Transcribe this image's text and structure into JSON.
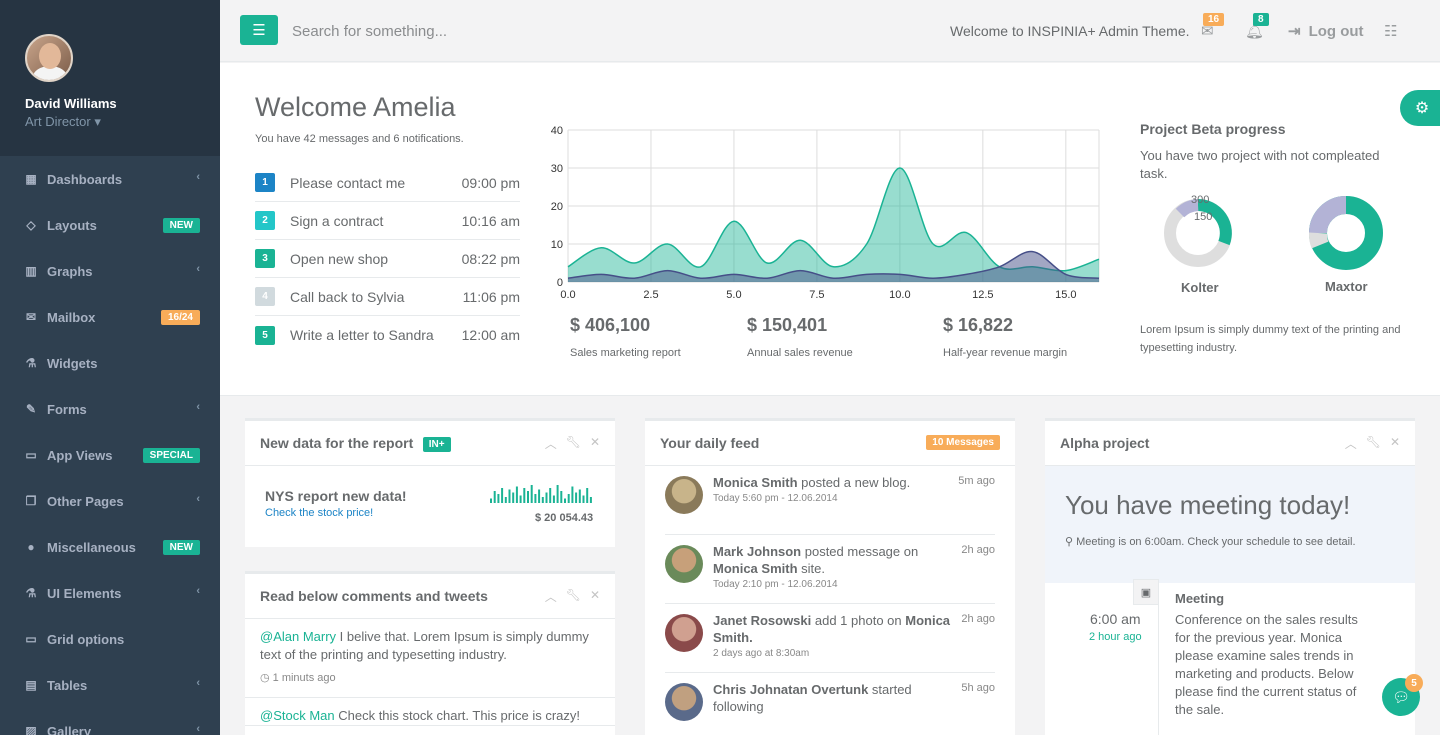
{
  "profile": {
    "name": "David Williams",
    "role": "Art Director ▾"
  },
  "nav": [
    {
      "label": "Dashboards",
      "icon": "th-large-icon",
      "chevron": true
    },
    {
      "label": "Layouts",
      "icon": "diamond-icon",
      "badge": "NEW",
      "badge_color": "#1ab394"
    },
    {
      "label": "Graphs",
      "icon": "bar-chart-icon",
      "chevron": true
    },
    {
      "label": "Mailbox",
      "icon": "envelope-icon",
      "badge": "16/24",
      "badge_color": "#f8ac59"
    },
    {
      "label": "Widgets",
      "icon": "flask-icon"
    },
    {
      "label": "Forms",
      "icon": "edit-icon",
      "chevron": true
    },
    {
      "label": "App Views",
      "icon": "desktop-icon",
      "badge": "SPECIAL",
      "badge_color": "#1ab394"
    },
    {
      "label": "Other Pages",
      "icon": "files-icon",
      "chevron": true
    },
    {
      "label": "Miscellaneous",
      "icon": "globe-icon",
      "badge": "NEW",
      "badge_color": "#1ab394"
    },
    {
      "label": "UI Elements",
      "icon": "flask-icon",
      "chevron": true
    },
    {
      "label": "Grid options",
      "icon": "laptop-icon"
    },
    {
      "label": "Tables",
      "icon": "table-icon",
      "chevron": true
    },
    {
      "label": "Gallery",
      "icon": "picture-icon",
      "chevron": true
    }
  ],
  "topbar": {
    "search_placeholder": "Search for something...",
    "welcome": "Welcome to INSPINIA+ Admin Theme.",
    "mail_count": "16",
    "alert_count": "8",
    "logout": "Log out"
  },
  "welcome": {
    "title": "Welcome Amelia",
    "subtitle": "You have 42 messages and 6 notifications.",
    "todos": [
      {
        "num": "1",
        "text": "Please contact me",
        "time": "09:00 pm",
        "color": "#1c84c6"
      },
      {
        "num": "2",
        "text": "Sign a contract",
        "time": "10:16 am",
        "color": "#23c6c8"
      },
      {
        "num": "3",
        "text": "Open new shop",
        "time": "08:22 pm",
        "color": "#1ab394"
      },
      {
        "num": "4",
        "text": "Call back to Sylvia",
        "time": "11:06 pm",
        "color": "#d1dade"
      },
      {
        "num": "5",
        "text": "Write a letter to Sandra",
        "time": "12:00 am",
        "color": "#1ab394"
      }
    ]
  },
  "stats": [
    {
      "value": "$ 406,100",
      "label": "Sales marketing report"
    },
    {
      "value": "$ 150,401",
      "label": "Annual sales revenue"
    },
    {
      "value": "$ 16,822",
      "label": "Half-year revenue margin"
    }
  ],
  "chart_data": {
    "type": "area",
    "xlim": [
      0,
      16
    ],
    "ylim": [
      0,
      40
    ],
    "x_ticks": [
      "0.0",
      "2.5",
      "5.0",
      "7.5",
      "10.0",
      "12.5",
      "15.0"
    ],
    "y_ticks": [
      "0",
      "10",
      "20",
      "30",
      "40"
    ],
    "grid": true,
    "series": [
      {
        "color": "#1ab394",
        "x": [
          0,
          1,
          2,
          3,
          4,
          5,
          6,
          7,
          8,
          9,
          10,
          11,
          12,
          13,
          14,
          15,
          16
        ],
        "y": [
          4,
          9,
          5,
          10,
          4,
          16,
          5,
          11,
          4,
          10,
          30,
          10,
          13,
          4,
          4,
          3,
          6
        ]
      },
      {
        "color": "#464f88",
        "x": [
          0,
          1,
          2,
          3,
          4,
          5,
          6,
          7,
          8,
          9,
          10,
          11,
          12,
          13,
          14,
          15,
          16
        ],
        "y": [
          1,
          2,
          1,
          3,
          1,
          2,
          1,
          3,
          1,
          2,
          2,
          1,
          2,
          4,
          8,
          2,
          1
        ]
      }
    ]
  },
  "projects": {
    "title": "Project Beta progress",
    "desc": "You have two project with not compleated task.",
    "items": [
      {
        "name": "Kolter",
        "labels": [
          "300",
          "150"
        ]
      },
      {
        "name": "Maxtor"
      }
    ],
    "footer": "Lorem Ipsum is simply dummy text of the printing and typesetting industry.",
    "colors": {
      "primary": "#1ab394",
      "secondary": "#b3b3d6",
      "neutral": "#dedede"
    }
  },
  "report": {
    "title": "New data for the report",
    "label": "IN+",
    "headline": "NYS report new data!",
    "link": "Check the stock price!",
    "value": "$ 20 054.43",
    "spark": [
      3,
      8,
      6,
      10,
      4,
      9,
      7,
      11,
      5,
      10,
      8,
      12,
      6,
      9,
      4,
      7,
      10,
      5,
      12,
      8,
      3,
      6,
      11,
      7,
      9,
      5,
      10,
      4
    ]
  },
  "comments": {
    "title": "Read below comments and tweets",
    "items": [
      {
        "handle": "@Alan Marry",
        "text": " I belive that. Lorem Ipsum is simply dummy text of the printing and typesetting industry.",
        "time": "1 minuts ago"
      },
      {
        "handle": "@Stock Man",
        "text": " Check this stock chart. This price is crazy!",
        "time": ""
      }
    ]
  },
  "feed": {
    "title": "Your daily feed",
    "badge": "10 Messages",
    "items": [
      {
        "who": "Monica Smith",
        "action": " posted a new blog.",
        "target": "",
        "when": "Today 5:60 pm - 12.06.2014",
        "ago": "5m ago"
      },
      {
        "who": "Mark Johnson",
        "action": " posted message on ",
        "target": "Monica Smith",
        "tail": " site.",
        "when": "Today 2:10 pm - 12.06.2014",
        "ago": "2h ago"
      },
      {
        "who": "Janet Rosowski",
        "action": " add 1 photo on ",
        "target": "Monica Smith.",
        "tail": "",
        "when": "2 days ago at 8:30am",
        "ago": "2h ago"
      },
      {
        "who": "Chris Johnatan Overtunk",
        "action": " started following",
        "target": "",
        "when": "",
        "ago": "5h ago"
      }
    ]
  },
  "alpha": {
    "title": "Alpha project",
    "headline": "You have meeting today!",
    "note": "Meeting is on 6:00am. Check your schedule to see detail.",
    "time": "6:00 am",
    "ago": "2 hour ago",
    "event_title": "Meeting",
    "event_desc": "Conference on the sales results for the previous year. Monica please examine sales trends in marketing and products. Below please find the current status of the sale."
  },
  "chat": {
    "count": "5"
  }
}
